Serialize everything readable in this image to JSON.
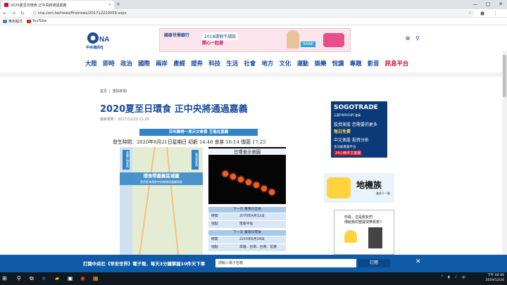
{
  "browser": {
    "tab_title": "2020夏至日環食 正中央將通過嘉義",
    "tab_close": "×",
    "new_tab": "+",
    "address": "cna.com.tw/news/firstnews/201712220059.aspx",
    "bookmarks": [
      "應用程式",
      "YouTube"
    ],
    "win_min": "—",
    "win_max": "□",
    "win_close": "✕"
  },
  "site": {
    "logo_text": "中央通訊社",
    "banner": {
      "bank": "國泰世華銀行",
      "line1": "2018請假不請款",
      "line2": "開心一起遊",
      "tag": "BANK"
    },
    "nav": [
      "大陸",
      "即時",
      "政治",
      "國際",
      "兩岸",
      "產經",
      "證券",
      "科技",
      "生活",
      "社會",
      "地方",
      "文化",
      "運動",
      "娛樂",
      "悅讀",
      "專題",
      "影音",
      "訊息平台"
    ]
  },
  "article": {
    "breadcrumb": [
      "首頁",
      "重點新聞"
    ],
    "title": "2020夏至日環食 正中央將通過嘉義",
    "date": "最新更新：2017/12/22 11:29"
  },
  "infographic": {
    "title": "百年難得一見天文奇景 王瑤在嘉義",
    "times": "發生時間：2020年6月21日星期日   初虧 14:46   食甚 16:14   復圓 17:25",
    "map_band": "環食帶嘉義區域圖",
    "map_sub": "黑色框為環食中央線通過嘉義地區",
    "side_left": "嘉義市環食帶",
    "side_right": "臺灣環食帶",
    "eclipse_title": "日環食示意圖",
    "next1_head": "下一次 臺灣日全食",
    "next1_time_label": "時間",
    "next1_time": "2070年4月11日",
    "next1_place_label": "地點",
    "next1_place": "恆春半島",
    "next2_head": "下一次 臺灣日環食",
    "next2_time_label": "時間",
    "next2_time": "2215年6月29日",
    "next2_place_label": "地點",
    "next2_place": "高雄、台南、台東、花蓮"
  },
  "ads": {
    "sogo": {
      "brand": "SOGOTRADE",
      "sub": "元富FINRA/SIPC會員",
      "l1": "投資美股 您需要的更多",
      "l2": "每日免費",
      "l3": "中文美股 投資分析",
      "l4": "多功能看盤平台",
      "l5": "24小時中文客服"
    },
    "dijizu": {
      "title": "地機族",
      "sub": "進化十一族"
    },
    "comic": {
      "l1": "你看，這是朋友們",
      "l2": "傳給我的聖誕快樂祝賀!!"
    }
  },
  "promo": {
    "text": "訂閱中央社《早安世界》電子報，每天3分鐘掌握10件天下事",
    "placeholder": "請輸入電子信箱",
    "button": "訂閱",
    "close": "✕"
  },
  "taskbar": {
    "time": "下午 04:46",
    "date": "2019/12/26"
  }
}
